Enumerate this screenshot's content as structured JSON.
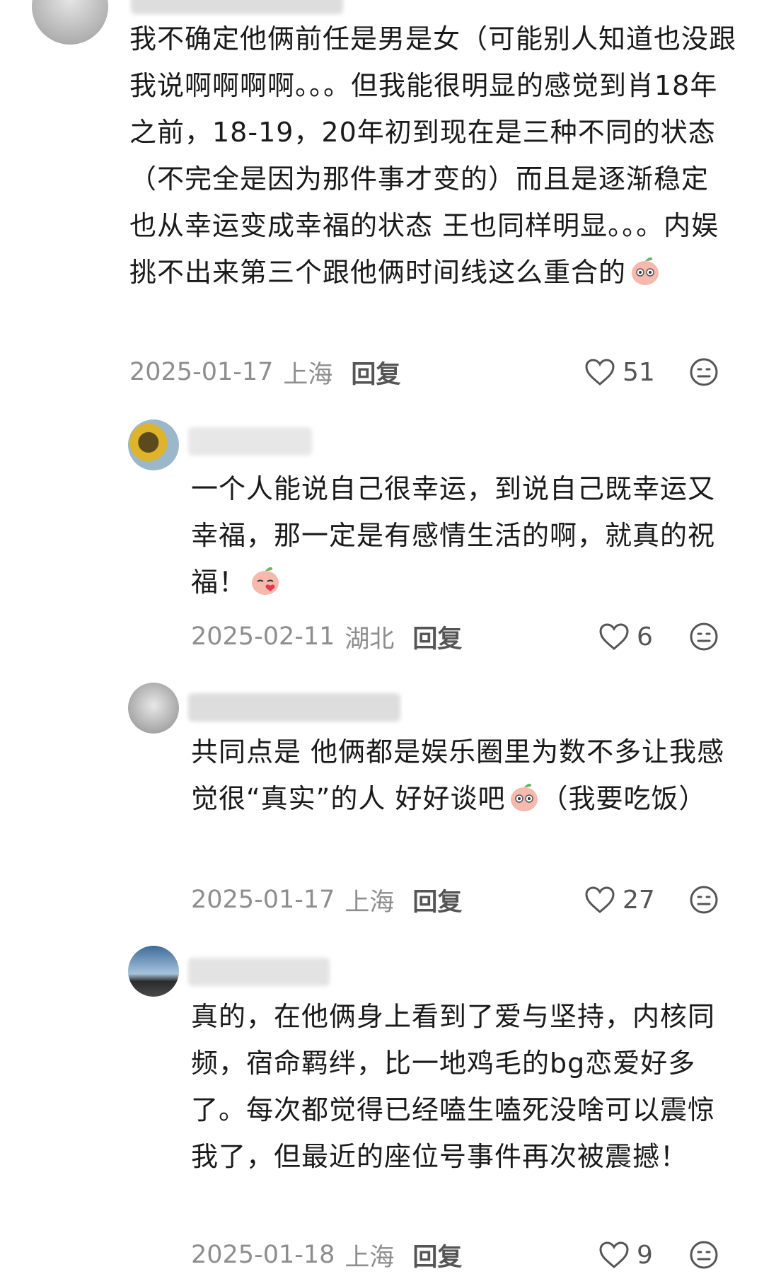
{
  "comments": [
    {
      "text": "我不确定他俩前任是男是女（可能别人知道也没跟我说啊啊啊啊。。。但我能很明显的感觉到肖18年之前，18-19，20年初到现在是三种不同的状态（不完全是因为那件事才变的）而且是逐渐稳定 也从幸运变成幸福的状态 王也同样明显。。。内娱挑不出来第三个跟他俩时间线这么重合的",
      "date": "2025-01-17",
      "location": "上海",
      "reply": "回复",
      "likes": "51"
    },
    {
      "text": "一个人能说自己很幸运，到说自己既幸运又幸福，那一定是有感情生活的啊，就真的祝福！",
      "date": "2025-02-11",
      "location": "湖北",
      "reply": "回复",
      "likes": "6"
    },
    {
      "text": "共同点是 他俩都是娱乐圈里为数不多让我感觉很“真实”的人 好好谈吧",
      "text_after": "（我要吃饭）",
      "date": "2025-01-17",
      "location": "上海",
      "reply": "回复",
      "likes": "27"
    },
    {
      "text": "真的，在他俩身上看到了爱与坚持，内核同频，宿命羁绊，比一地鸡毛的bg恋爱好多了。每次都觉得已经嗑生嗑死没啥可以震惊我了，但最近的座位号事件再次被震撼！",
      "date": "2025-01-18",
      "location": "上海",
      "reply": "回复",
      "likes": "9"
    }
  ],
  "icons": {
    "like": "heart-outline-icon",
    "react": "emoji-face-icon",
    "sticker": "peach-sticker-icon"
  }
}
